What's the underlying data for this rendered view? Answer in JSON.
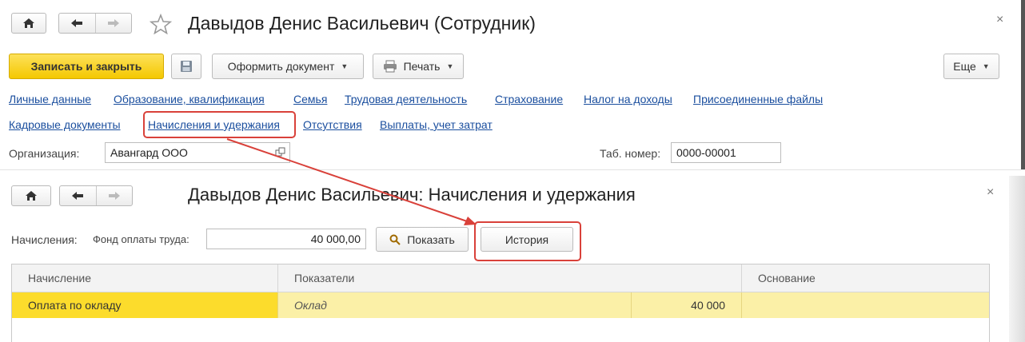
{
  "upper": {
    "title": "Давыдов Денис Васильевич (Сотрудник)",
    "close": "×",
    "toolbar": {
      "save_close": "Записать и закрыть",
      "formalize": "Оформить документ",
      "print": "Печать",
      "more": "Еще"
    },
    "links_row1": [
      "Личные данные",
      "Образование, квалификация",
      "Семья",
      "Трудовая деятельность",
      "Страхование",
      "Налог на доходы",
      "Присоединенные файлы"
    ],
    "links_row2": [
      "Кадровые документы",
      "Начисления и удержания",
      "Отсутствия",
      "Выплаты, учет затрат"
    ],
    "org_label": "Организация:",
    "org_value": "Авангард ООО",
    "tab_label": "Таб. номер:",
    "tab_value": "0000-00001"
  },
  "lower": {
    "title": "Давыдов Денис Васильевич: Начисления и удержания",
    "close": "×",
    "accruals_label": "Начисления:",
    "fund_label": "Фонд оплаты труда:",
    "fund_value": "40 000,00",
    "show_button": "Показать",
    "history_button": "История",
    "table": {
      "headers": [
        "Начисление",
        "Показатели",
        "Основание"
      ],
      "rows": [
        {
          "accrual": "Оплата по окладу",
          "indicator": "Оклад",
          "indicator_value": "40 000",
          "basis": ""
        }
      ]
    }
  },
  "colors": {
    "primary_button": "#f4c800",
    "link": "#1a4e9e",
    "highlight_box": "#d9413a",
    "selected_row": "#fbf0a7",
    "selected_cell": "#fcdc2c"
  },
  "icons": [
    "home-icon",
    "back-arrow-icon",
    "forward-arrow-icon",
    "star-icon",
    "close-icon",
    "floppy-disk-icon",
    "printer-icon",
    "open-form-icon",
    "magnifier-icon"
  ]
}
